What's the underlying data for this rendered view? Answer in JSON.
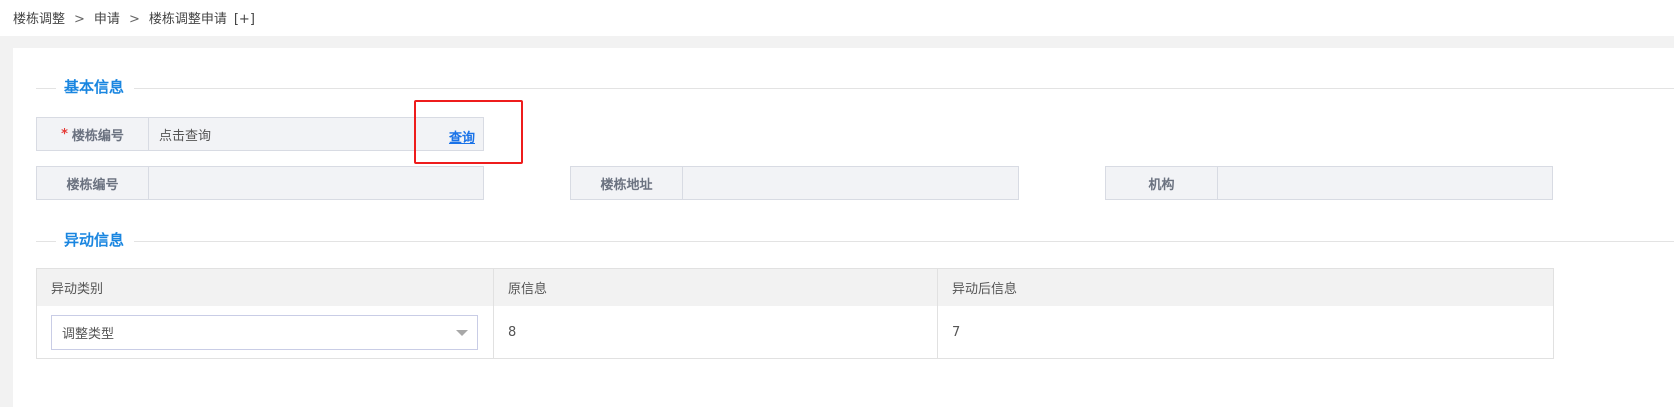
{
  "breadcrumb": {
    "items": [
      "楼栋调整",
      "申请",
      "楼栋调整申请"
    ],
    "separator": ">",
    "expand": "[+]"
  },
  "sections": {
    "basic": "基本信息",
    "change": "异动信息"
  },
  "query_field": {
    "required_mark": "*",
    "label": "楼栋编号",
    "placeholder": "点击查询",
    "action": "查询"
  },
  "info_fields": [
    {
      "label": "楼栋编号",
      "value": ""
    },
    {
      "label": "楼栋地址",
      "value": ""
    },
    {
      "label": "机构",
      "value": ""
    }
  ],
  "change_table": {
    "headers": [
      "异动类别",
      "原信息",
      "异动后信息"
    ],
    "rows": [
      {
        "type_select": "调整类型",
        "original": "8",
        "changed": "7"
      }
    ]
  },
  "colors": {
    "accent": "#1a86e0",
    "link": "#1a73e8",
    "required": "#e53935",
    "highlight": "#ee1c1c"
  }
}
